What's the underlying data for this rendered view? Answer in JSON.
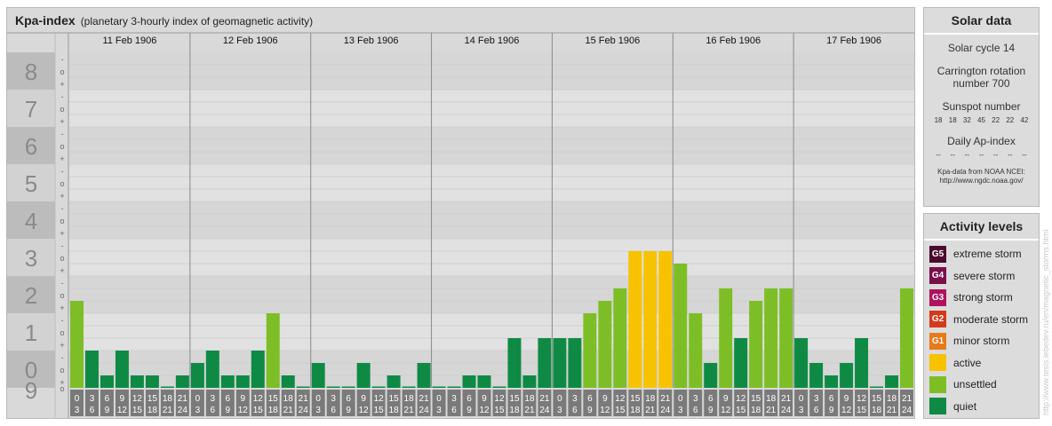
{
  "title": "Kpa-index",
  "subtitle": "(planetary 3-hourly index of geomagnetic activity)",
  "chart_data": {
    "type": "bar",
    "ylim": [
      0,
      9
    ],
    "y_ticks": [
      "0",
      "1",
      "2",
      "3",
      "4",
      "5",
      "6",
      "7",
      "8",
      "9"
    ],
    "minor_tick_symbols": [
      "+",
      "o",
      "-"
    ],
    "x_interval_labels": [
      [
        "0",
        "3"
      ],
      [
        "3",
        "6"
      ],
      [
        "6",
        "9"
      ],
      [
        "9",
        "12"
      ],
      [
        "12",
        "15"
      ],
      [
        "15",
        "18"
      ],
      [
        "18",
        "21"
      ],
      [
        "21",
        "24"
      ]
    ],
    "days": [
      {
        "label": "11 Feb 1906",
        "values": [
          2.333,
          1.0,
          0.333,
          1.0,
          0.333,
          0.333,
          0,
          0.333
        ]
      },
      {
        "label": "12 Feb 1906",
        "values": [
          0.667,
          1.0,
          0.333,
          0.333,
          1.0,
          2.0,
          0.333,
          0
        ]
      },
      {
        "label": "13 Feb 1906",
        "values": [
          0.667,
          0,
          0,
          0.667,
          0,
          0.333,
          0,
          0.667
        ]
      },
      {
        "label": "14 Feb 1906",
        "values": [
          0,
          0,
          0.333,
          0.333,
          0,
          1.333,
          0.333,
          1.333
        ]
      },
      {
        "label": "15 Feb 1906",
        "values": [
          1.333,
          1.333,
          2.0,
          2.333,
          2.667,
          3.667,
          3.667,
          3.667
        ]
      },
      {
        "label": "16 Feb 1906",
        "values": [
          3.333,
          2.0,
          0.667,
          2.667,
          1.333,
          2.333,
          2.667,
          2.667
        ]
      },
      {
        "label": "17 Feb 1906",
        "values": [
          1.333,
          0.667,
          0.333,
          0.667,
          1.333,
          0,
          0.333,
          2.667
        ]
      }
    ]
  },
  "solar": {
    "title": "Solar data",
    "cycle": "Solar cycle 14",
    "carrington_line1": "Carrington rotation",
    "carrington_line2": "number 700",
    "sunspot_title": "Sunspot number",
    "sunspot_values": [
      "18",
      "18",
      "32",
      "45",
      "22",
      "22",
      "42"
    ],
    "ap_title": "Daily Ap-index",
    "ap_values": [
      "--",
      "--",
      "--",
      "--",
      "--",
      "--",
      "--"
    ],
    "credit_line1": "Kpa-data from NOAA NCEI:",
    "credit_line2": "http://www.ngdc.noaa.gov/"
  },
  "levels": {
    "title": "Activity levels",
    "items": [
      {
        "code": "G5",
        "label": "extreme storm",
        "color": "#4d0a2e"
      },
      {
        "code": "G4",
        "label": "severe storm",
        "color": "#7a0f4a"
      },
      {
        "code": "G3",
        "label": "strong storm",
        "color": "#b0125f"
      },
      {
        "code": "G2",
        "label": "moderate storm",
        "color": "#d43a1a"
      },
      {
        "code": "G1",
        "label": "minor storm",
        "color": "#e87a1a"
      },
      {
        "code": "",
        "label": "active",
        "color": "#f7c200"
      },
      {
        "code": "",
        "label": "unsettled",
        "color": "#7dbe26"
      },
      {
        "code": "",
        "label": "quiet",
        "color": "#0e8a45"
      }
    ]
  },
  "watermark": "http://www.tesis.lebedev.ru/en/magnetic_storms.html"
}
